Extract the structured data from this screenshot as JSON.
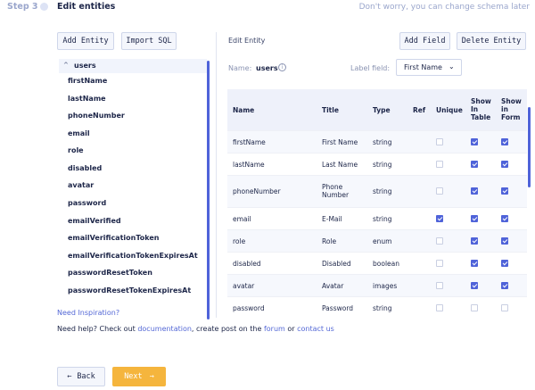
{
  "header": {
    "step": "Step 3",
    "title": "Edit entities",
    "hint": "Don't worry, you can change schema later"
  },
  "left": {
    "add_entity": "Add Entity",
    "import_sql": "Import SQL",
    "entity": "users",
    "fields": [
      "firstName",
      "lastName",
      "phoneNumber",
      "email",
      "role",
      "disabled",
      "avatar",
      "password",
      "emailVerified",
      "emailVerificationToken",
      "emailVerificationTokenExpiresAt",
      "passwordResetToken",
      "passwordResetTokenExpiresAt"
    ],
    "inspiration": "Need Inspiration?"
  },
  "right": {
    "title": "Edit Entity",
    "add_field": "Add Field",
    "delete_entity": "Delete Entity",
    "name_label": "Name:",
    "name_value": "users",
    "label_field_label": "Label field:",
    "label_field_value": "First Name",
    "columns": {
      "name": "Name",
      "title": "Title",
      "type": "Type",
      "ref": "Ref",
      "unique": "Unique",
      "show_table": [
        "Show",
        "In",
        "Table"
      ],
      "show_form": [
        "Show",
        "in",
        "Form"
      ]
    },
    "rows": [
      {
        "name": "firstName",
        "title": [
          "First Name"
        ],
        "type": "string",
        "unique": false,
        "table": true,
        "form": true
      },
      {
        "name": "lastName",
        "title": [
          "Last Name"
        ],
        "type": "string",
        "unique": false,
        "table": true,
        "form": true
      },
      {
        "name": "phoneNumber",
        "title": [
          "Phone",
          "Number"
        ],
        "type": "string",
        "unique": false,
        "table": true,
        "form": true
      },
      {
        "name": "email",
        "title": [
          "E-Mail"
        ],
        "type": "string",
        "unique": true,
        "table": true,
        "form": true
      },
      {
        "name": "role",
        "title": [
          "Role"
        ],
        "type": "enum",
        "unique": false,
        "table": true,
        "form": true
      },
      {
        "name": "disabled",
        "title": [
          "Disabled"
        ],
        "type": "boolean",
        "unique": false,
        "table": true,
        "form": true
      },
      {
        "name": "avatar",
        "title": [
          "Avatar"
        ],
        "type": "images",
        "unique": false,
        "table": true,
        "form": true
      },
      {
        "name": "password",
        "title": [
          "Password"
        ],
        "type": "string",
        "unique": false,
        "table": false,
        "form": false
      }
    ]
  },
  "help": {
    "prefix": "Need help? Check out ",
    "documentation": "documentation",
    "middle": ", create post on the ",
    "forum": "forum",
    "or": " or ",
    "contact": "contact us"
  },
  "nav": {
    "back": "Back",
    "next": "Next",
    "back_icon": "←",
    "next_icon": "→"
  }
}
